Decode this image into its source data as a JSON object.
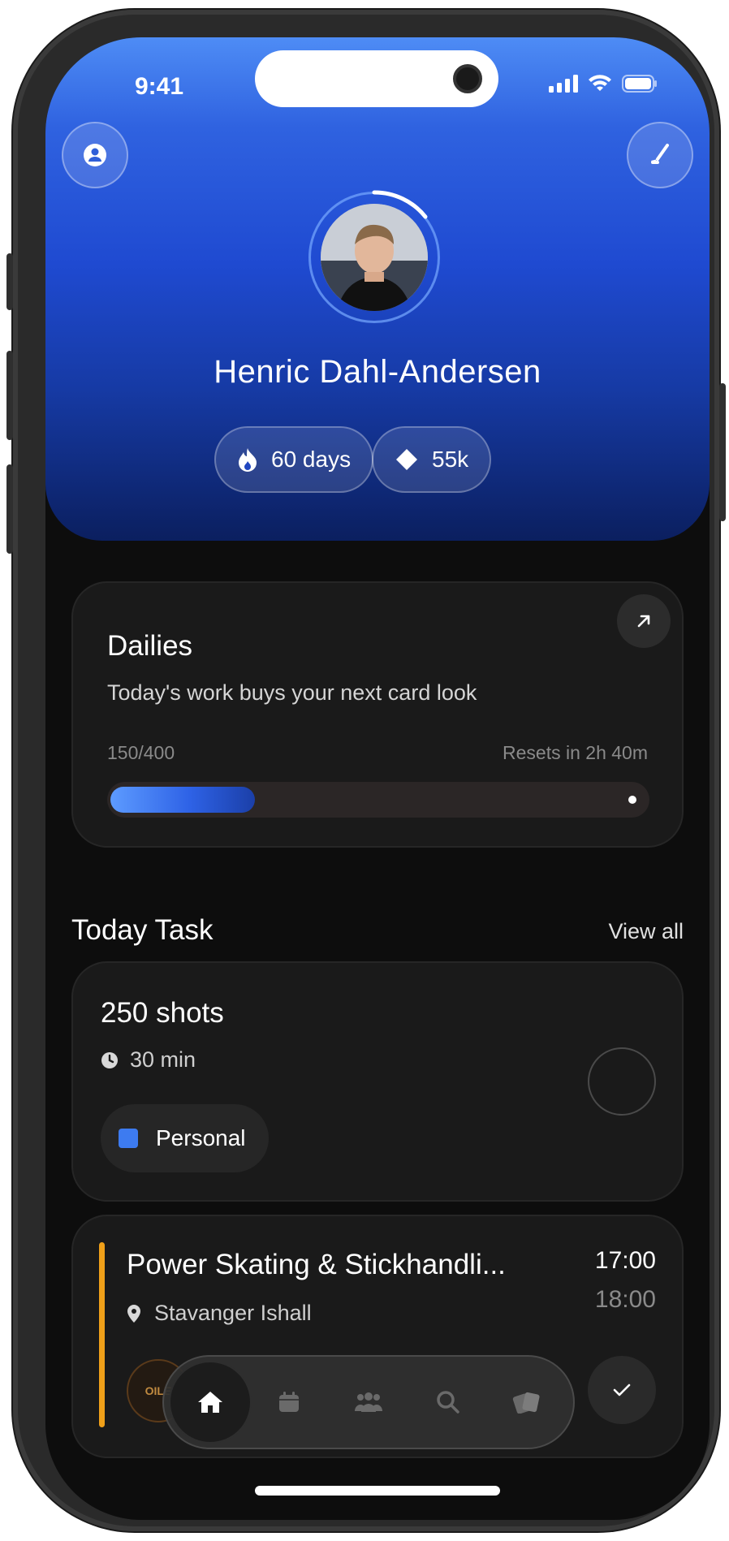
{
  "status_bar": {
    "time": "9:41"
  },
  "header": {
    "user_name": "Henric Dahl-Andersen",
    "streak_label": "60 days",
    "points_label": "55k"
  },
  "dailies": {
    "title": "Dailies",
    "subtitle": "Today's work buys your next card look",
    "progress_text": "150/400",
    "progress_value": 0.375,
    "reset_text": "Resets in 2h 40m"
  },
  "today_task": {
    "section_title": "Today Task",
    "view_all_label": "View all",
    "tasks": [
      {
        "title": "250 shots",
        "duration": "30 min",
        "tag": "Personal",
        "tag_color": "#3d7bf0"
      },
      {
        "title": "Power Skating & Stickhandli...",
        "location": "Stavanger Ishall",
        "start": "17:00",
        "end": "18:00",
        "club": "OILE",
        "accent_color": "#f0a019"
      }
    ]
  },
  "tabbar": {
    "items": [
      {
        "icon": "home-icon",
        "active": true
      },
      {
        "icon": "calendar-icon",
        "active": false
      },
      {
        "icon": "team-icon",
        "active": false
      },
      {
        "icon": "search-icon",
        "active": false
      },
      {
        "icon": "cards-icon",
        "active": false
      }
    ]
  },
  "colors": {
    "header_gradient_top": "#4e8cf5",
    "header_gradient_bottom": "#0b1f5f",
    "background": "#0d0d0d",
    "card": "#1a1a1a",
    "accent_blue": "#3d7bf0",
    "accent_orange": "#f0a019"
  }
}
